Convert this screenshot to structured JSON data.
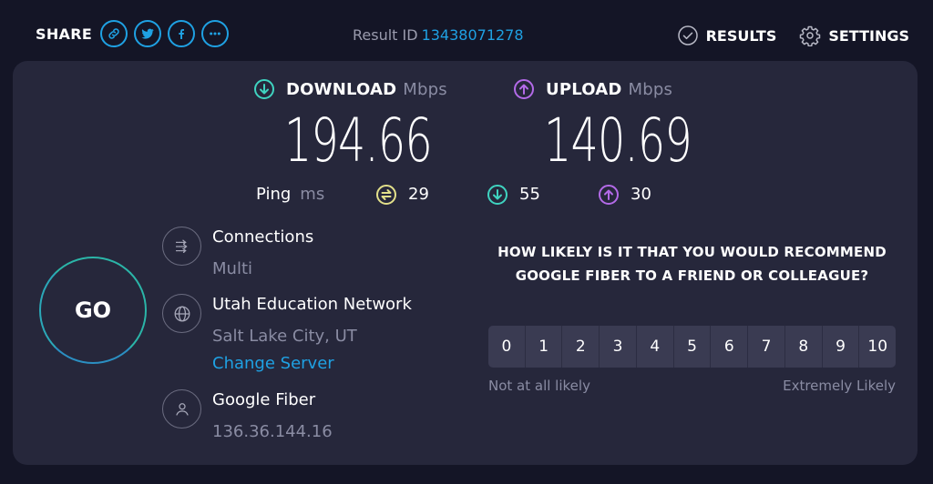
{
  "header": {
    "share_label": "SHARE",
    "share_buttons": [
      {
        "icon": "link-icon",
        "label": "Copy link"
      },
      {
        "icon": "twitter-icon",
        "label": "Twitter"
      },
      {
        "icon": "facebook-icon",
        "label": "Facebook"
      },
      {
        "icon": "more-icon",
        "label": "More"
      }
    ],
    "result_id_label": "Result ID",
    "result_id": "13438071278",
    "nav": {
      "results": "RESULTS",
      "settings": "SETTINGS"
    }
  },
  "colors": {
    "accent_blue": "#1fa1e3",
    "download_teal": "#3fd3c0",
    "upload_purple": "#b36ae8",
    "ping_yellow": "#e3e08a",
    "background": "#141526",
    "panel": "#26273b"
  },
  "speeds": {
    "download": {
      "label": "DOWNLOAD",
      "unit": "Mbps",
      "value": "194.66"
    },
    "upload": {
      "label": "UPLOAD",
      "unit": "Mbps",
      "value": "140.69"
    }
  },
  "ping": {
    "label": "Ping",
    "unit": "ms",
    "idle": "29",
    "download": "55",
    "upload": "30"
  },
  "go_button": "GO",
  "connections": {
    "title": "Connections",
    "value": "Multi"
  },
  "server": {
    "title": "Utah Education Network",
    "location": "Salt Lake City, UT",
    "change_label": "Change Server"
  },
  "provider": {
    "title": "Google Fiber",
    "ip": "136.36.144.16"
  },
  "survey": {
    "question": "HOW LIKELY IS IT THAT YOU WOULD RECOMMEND GOOGLE FIBER TO A FRIEND OR COLLEAGUE?",
    "options": [
      "0",
      "1",
      "2",
      "3",
      "4",
      "5",
      "6",
      "7",
      "8",
      "9",
      "10"
    ],
    "low_label": "Not at all likely",
    "high_label": "Extremely Likely"
  }
}
